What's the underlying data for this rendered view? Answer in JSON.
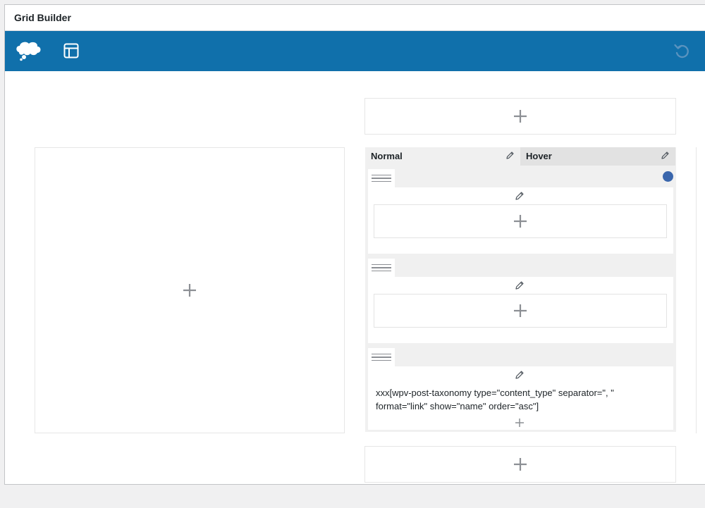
{
  "window": {
    "title": "Grid Builder"
  },
  "toolbar": {
    "icons": [
      "toolset-logo-icon",
      "layout-icon",
      "undo-icon"
    ],
    "background": "#1070ab"
  },
  "canvas": {
    "tabs": [
      {
        "label": "Normal",
        "active": true
      },
      {
        "label": "Hover",
        "active": false
      }
    ],
    "rows": [
      {
        "content": ""
      },
      {
        "content": ""
      },
      {
        "content": "xxx[wpv-post-taxonomy type=\"content_type\" separator=\", \" format=\"link\" show=\"name\" order=\"asc\"]"
      }
    ]
  },
  "colors": {
    "accent": "#1070ab",
    "status_dot": "#3a66ac",
    "plus": "#8c8f94"
  }
}
